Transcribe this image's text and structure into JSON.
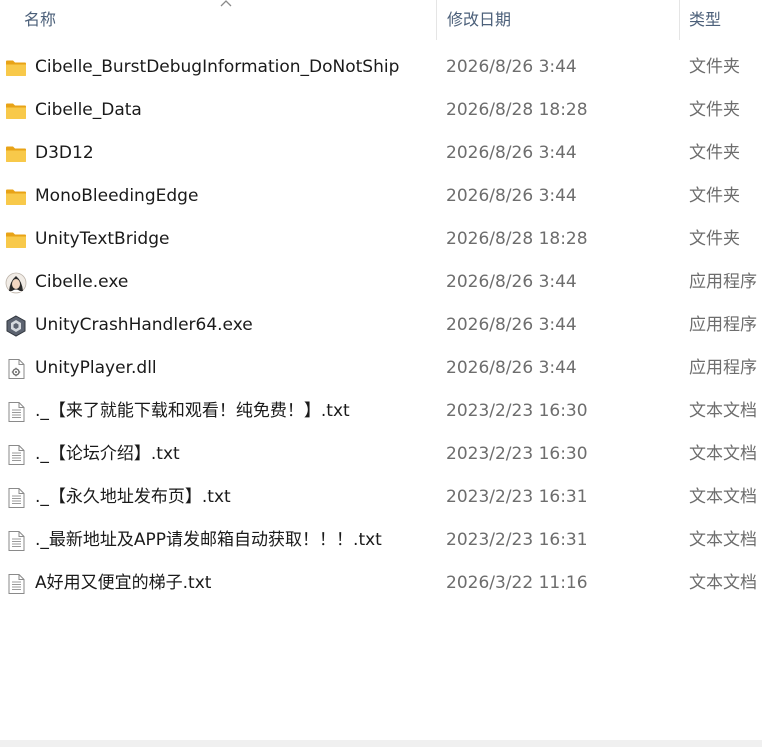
{
  "columns": {
    "name": "名称",
    "date": "修改日期",
    "type": "类型"
  },
  "colors": {
    "folder": "#f5c043",
    "header_text": "#4c607a",
    "item_text": "#1a1a1a",
    "meta_text": "#6d6d6d"
  },
  "files": [
    {
      "name": "Cibelle_BurstDebugInformation_DoNotShip",
      "date": "2026/8/26 3:44",
      "type": "文件夹",
      "icon": "folder-icon"
    },
    {
      "name": "Cibelle_Data",
      "date": "2026/8/28 18:28",
      "type": "文件夹",
      "icon": "folder-icon"
    },
    {
      "name": "D3D12",
      "date": "2026/8/26 3:44",
      "type": "文件夹",
      "icon": "folder-icon"
    },
    {
      "name": "MonoBleedingEdge",
      "date": "2026/8/26 3:44",
      "type": "文件夹",
      "icon": "folder-icon"
    },
    {
      "name": "UnityTextBridge",
      "date": "2026/8/28 18:28",
      "type": "文件夹",
      "icon": "folder-icon"
    },
    {
      "name": "Cibelle.exe",
      "date": "2026/8/26 3:44",
      "type": "应用程序",
      "icon": "app-avatar-icon"
    },
    {
      "name": "UnityCrashHandler64.exe",
      "date": "2026/8/26 3:44",
      "type": "应用程序",
      "icon": "unity-icon"
    },
    {
      "name": "UnityPlayer.dll",
      "date": "2026/8/26 3:44",
      "type": "应用程序",
      "icon": "dll-icon"
    },
    {
      "name": "._【来了就能下载和观看！纯免费！】.txt",
      "date": "2023/2/23 16:30",
      "type": "文本文档",
      "icon": "text-file-icon"
    },
    {
      "name": "._【论坛介绍】.txt",
      "date": "2023/2/23 16:30",
      "type": "文本文档",
      "icon": "text-file-icon"
    },
    {
      "name": "._【永久地址发布页】.txt",
      "date": "2023/2/23 16:31",
      "type": "文本文档",
      "icon": "text-file-icon"
    },
    {
      "name": "._最新地址及APP请发邮箱自动获取！！！.txt",
      "date": "2023/2/23 16:31",
      "type": "文本文档",
      "icon": "text-file-icon"
    },
    {
      "name": "A好用又便宜的梯子.txt",
      "date": "2026/3/22 11:16",
      "type": "文本文档",
      "icon": "text-file-icon"
    }
  ]
}
